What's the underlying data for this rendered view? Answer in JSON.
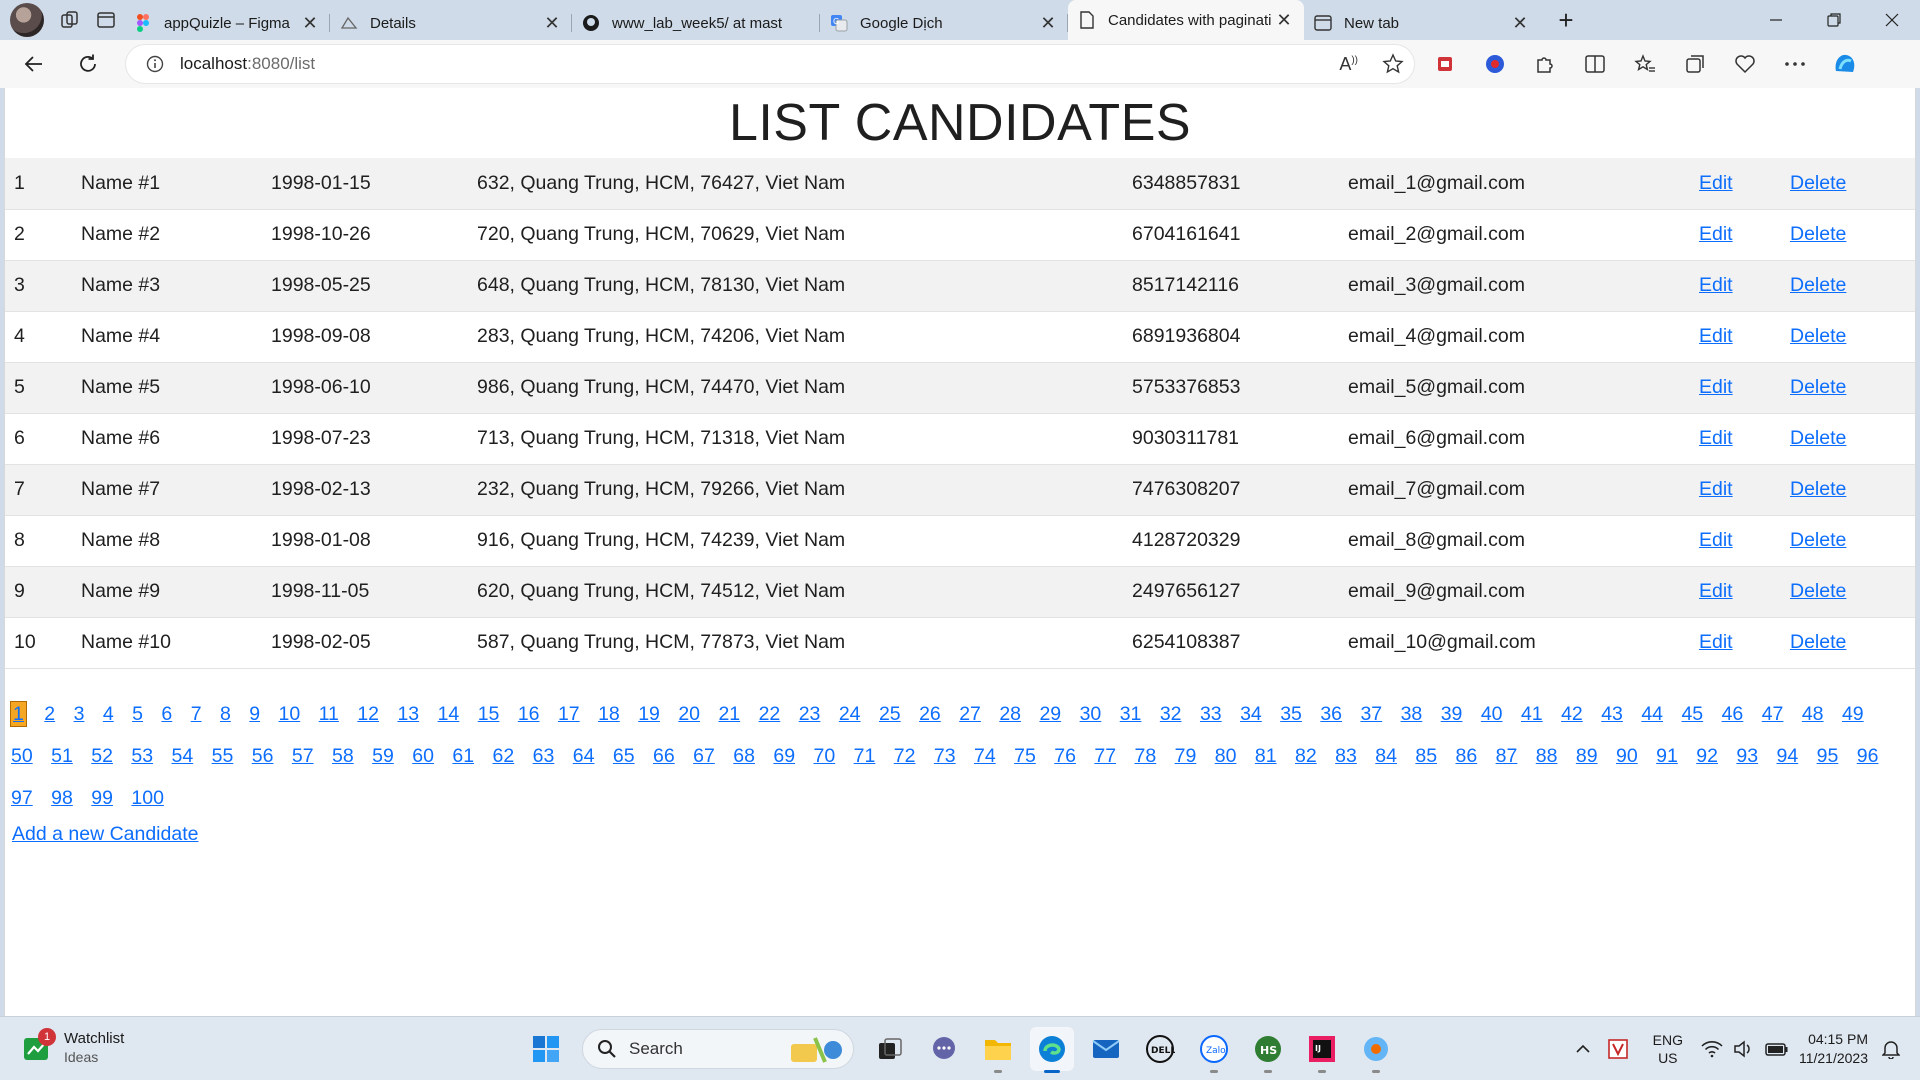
{
  "browser": {
    "tabs": [
      {
        "title": "appQuizle – Figma",
        "icon": "figma-icon",
        "active": false
      },
      {
        "title": "Details",
        "icon": "cloud-icon",
        "active": false
      },
      {
        "title": "www_lab_week5/ at mast",
        "icon": "github-icon",
        "active": false
      },
      {
        "title": "Google Dịch",
        "icon": "google-translate-icon",
        "active": false
      },
      {
        "title": "Candidates with paginati",
        "icon": "page-icon",
        "active": true
      },
      {
        "title": "New tab",
        "icon": "new-tab-icon",
        "active": false
      }
    ],
    "address": {
      "host": "localhost",
      "path": ":8080/list"
    }
  },
  "page": {
    "title": "LIST CANDIDATES",
    "edit_label": "Edit",
    "delete_label": "Delete",
    "candidates": [
      {
        "id": "1",
        "name": "Name #1",
        "dob": "1998-01-15",
        "address": "632, Quang Trung, HCM, 76427, Viet Nam",
        "phone": "6348857831",
        "email": "email_1@gmail.com"
      },
      {
        "id": "2",
        "name": "Name #2",
        "dob": "1998-10-26",
        "address": "720, Quang Trung, HCM, 70629, Viet Nam",
        "phone": "6704161641",
        "email": "email_2@gmail.com"
      },
      {
        "id": "3",
        "name": "Name #3",
        "dob": "1998-05-25",
        "address": "648, Quang Trung, HCM, 78130, Viet Nam",
        "phone": "8517142116",
        "email": "email_3@gmail.com"
      },
      {
        "id": "4",
        "name": "Name #4",
        "dob": "1998-09-08",
        "address": "283, Quang Trung, HCM, 74206, Viet Nam",
        "phone": "6891936804",
        "email": "email_4@gmail.com"
      },
      {
        "id": "5",
        "name": "Name #5",
        "dob": "1998-06-10",
        "address": "986, Quang Trung, HCM, 74470, Viet Nam",
        "phone": "5753376853",
        "email": "email_5@gmail.com"
      },
      {
        "id": "6",
        "name": "Name #6",
        "dob": "1998-07-23",
        "address": "713, Quang Trung, HCM, 71318, Viet Nam",
        "phone": "9030311781",
        "email": "email_6@gmail.com"
      },
      {
        "id": "7",
        "name": "Name #7",
        "dob": "1998-02-13",
        "address": "232, Quang Trung, HCM, 79266, Viet Nam",
        "phone": "7476308207",
        "email": "email_7@gmail.com"
      },
      {
        "id": "8",
        "name": "Name #8",
        "dob": "1998-01-08",
        "address": "916, Quang Trung, HCM, 74239, Viet Nam",
        "phone": "4128720329",
        "email": "email_8@gmail.com"
      },
      {
        "id": "9",
        "name": "Name #9",
        "dob": "1998-11-05",
        "address": "620, Quang Trung, HCM, 74512, Viet Nam",
        "phone": "2497656127",
        "email": "email_9@gmail.com"
      },
      {
        "id": "10",
        "name": "Name #10",
        "dob": "1998-02-05",
        "address": "587, Quang Trung, HCM, 77873, Viet Nam",
        "phone": "6254108387",
        "email": "email_10@gmail.com"
      }
    ],
    "pagination": {
      "first_page": 1,
      "last_page": 100,
      "current_page": 1
    },
    "add_link": "Add a new Candidate"
  },
  "taskbar": {
    "widget": {
      "title": "Watchlist",
      "subtitle": "Ideas",
      "badge": "1"
    },
    "search_label": "Search",
    "language": {
      "line1": "ENG",
      "line2": "US"
    },
    "clock": {
      "time": "04:15 PM",
      "date": "11/21/2023"
    }
  },
  "colors": {
    "link": "#0d6efd",
    "current_page_bg": "#f5a623",
    "taskbar": "#dfe7f0"
  }
}
